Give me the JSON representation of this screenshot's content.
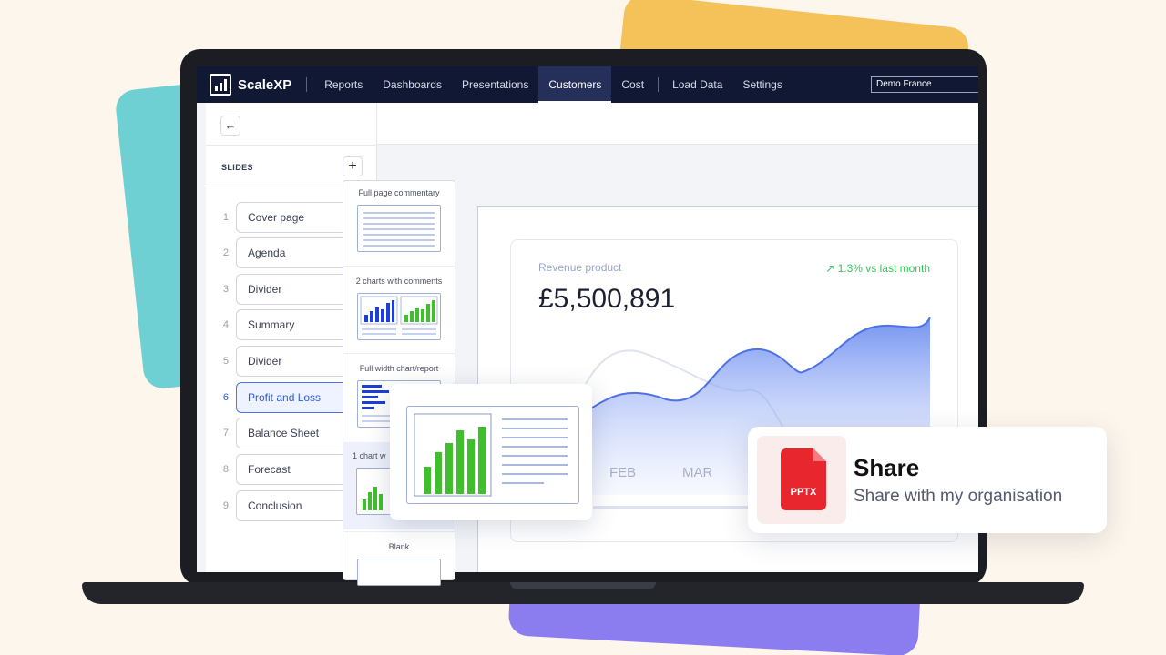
{
  "app": {
    "brand_name": "ScaleXP",
    "nav": [
      {
        "label": "Reports"
      },
      {
        "label": "Dashboards"
      },
      {
        "label": "Presentations"
      },
      {
        "label": "Customers"
      },
      {
        "label": "Cost"
      },
      {
        "label": "Load Data"
      },
      {
        "label": "Settings"
      }
    ],
    "active_nav": "Customers",
    "org_selector": "Demo France"
  },
  "slides_panel": {
    "title": "SLIDES",
    "back_icon": "arrow-left-icon",
    "add_icon": "plus-icon",
    "slides": [
      {
        "num": "1",
        "label": "Cover page"
      },
      {
        "num": "2",
        "label": "Agenda"
      },
      {
        "num": "3",
        "label": "Divider"
      },
      {
        "num": "4",
        "label": "Summary"
      },
      {
        "num": "5",
        "label": "Divider"
      },
      {
        "num": "6",
        "label": "Profit and Loss"
      },
      {
        "num": "7",
        "label": "Balance Sheet"
      },
      {
        "num": "8",
        "label": "Forecast"
      },
      {
        "num": "9",
        "label": "Conclusion"
      }
    ],
    "active_slide": "6"
  },
  "layout_picker": {
    "options": [
      {
        "label": "Full page commentary"
      },
      {
        "label": "2 charts with comments"
      },
      {
        "label": "Full width chart/report"
      },
      {
        "label": "1 chart w"
      },
      {
        "label": "Blank"
      }
    ]
  },
  "revenue_card": {
    "label": "Revenue product",
    "change": "1.3% vs last month",
    "change_icon": "arrow-up-right-icon",
    "value": "£5,500,891",
    "months": [
      "FEB",
      "MAR"
    ]
  },
  "share_card": {
    "file_type": "PPTX",
    "title": "Share",
    "subtitle": "Share with my organisation"
  },
  "colors": {
    "nav_bg": "#111833",
    "accent_blue": "#2e5bd6",
    "accent_green": "#34c759",
    "bar_green": "#3fbf2c",
    "bar_blue": "#1d3fd6",
    "pptx_red": "#e8262d"
  }
}
